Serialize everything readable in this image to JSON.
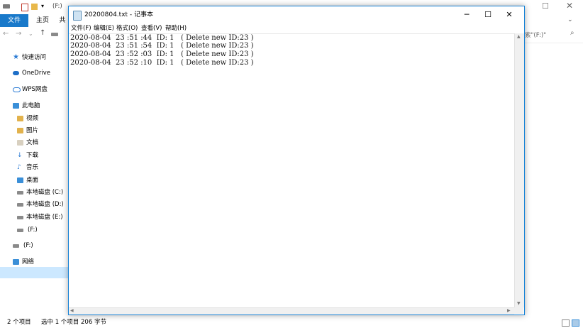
{
  "explorer": {
    "title_drive": "(F:)",
    "ribbon_tabs": [
      "文件",
      "主页",
      "共"
    ],
    "search_fragment": "索\"(F:)\"",
    "nav": {
      "quick_access": "快速访问",
      "onedrive": "OneDrive",
      "wps": "WPS网盘",
      "this_pc": "此电脑",
      "videos": "视频",
      "pictures": "图片",
      "documents": "文档",
      "downloads": "下载",
      "music": "音乐",
      "desktop": "桌面",
      "disk_c": "本地磁盘 (C:)",
      "disk_d": "本地磁盘 (D:)",
      "disk_e": "本地磁盘 (E:)",
      "drive_f": "(F:)",
      "drive_f2": "(F:)",
      "network": "网络"
    },
    "status": {
      "items": "2 个项目",
      "selected": "选中 1 个项目  206 字节"
    }
  },
  "notepad": {
    "title": "20200804.txt - 记事本",
    "menu": [
      "文件(F)",
      "编辑(E)",
      "格式(O)",
      "查看(V)",
      "帮助(H)"
    ],
    "lines": [
      "2020-08-04  23 :51 :44  ID: 1   ( Delete new ID:23 )",
      "2020-08-04  23 :51 :54  ID: 1   ( Delete new ID:23 )",
      "2020-08-04  23 :52 :03  ID: 1   ( Delete new ID:23 )",
      "2020-08-04  23 :52 :10  ID: 1   ( Delete new ID:23 )"
    ]
  },
  "colors": {
    "accent": "#1979ca",
    "selection": "#cce8ff",
    "window_border": "#1883d7"
  }
}
